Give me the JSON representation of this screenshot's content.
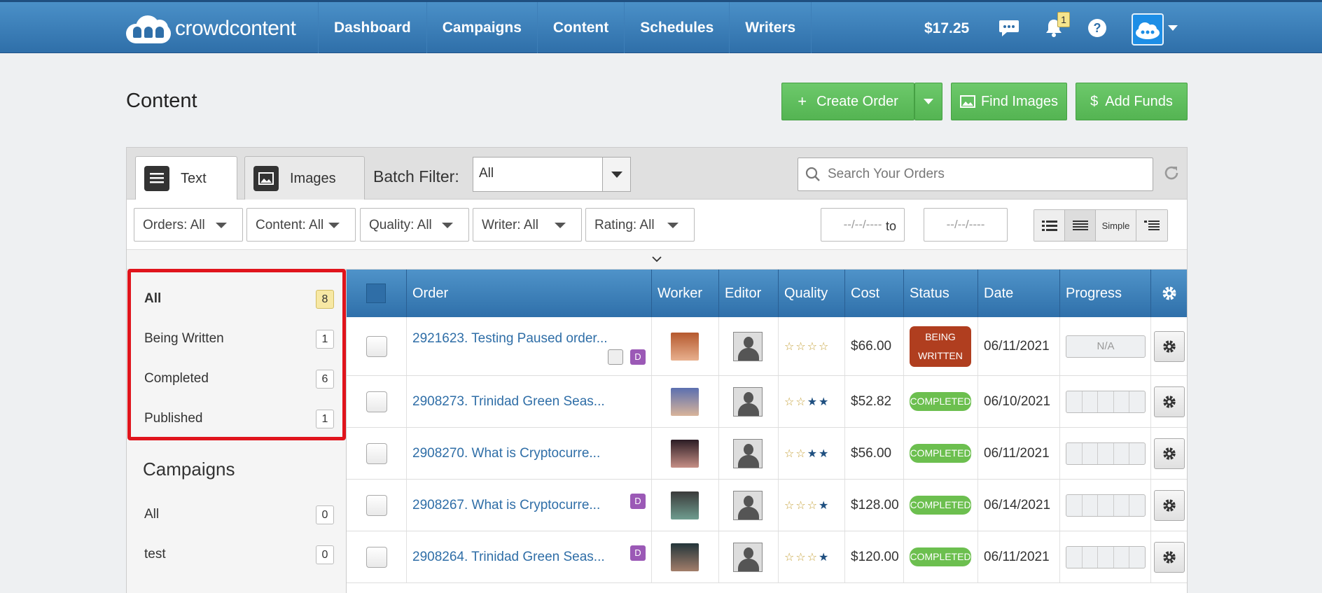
{
  "header": {
    "logo_text": "crowdcontent",
    "nav": [
      "Dashboard",
      "Campaigns",
      "Content",
      "Schedules",
      "Writers"
    ],
    "balance": "$17.25",
    "notification_count": "1"
  },
  "page": {
    "title": "Content",
    "buttons": {
      "create_order": "Create Order",
      "find_images": "Find Images",
      "add_funds": "Add Funds"
    }
  },
  "tabs": {
    "text": "Text",
    "images": "Images"
  },
  "batch": {
    "label": "Batch Filter:",
    "value": "All"
  },
  "search": {
    "placeholder": "Search Your Orders"
  },
  "filters": {
    "orders": "Orders: All",
    "content": "Content: All",
    "quality": "Quality: All",
    "writer": "Writer: All",
    "rating": "Rating: All",
    "date_from": "--/--/----",
    "to": "to",
    "date_to": "--/--/----",
    "view_simple": "Simple"
  },
  "sidebar": {
    "statuses": [
      {
        "label": "All",
        "count": "8"
      },
      {
        "label": "Being Written",
        "count": "1"
      },
      {
        "label": "Completed",
        "count": "6"
      },
      {
        "label": "Published",
        "count": "1"
      }
    ],
    "campaigns_title": "Campaigns",
    "campaigns": [
      {
        "label": "All",
        "count": "0"
      },
      {
        "label": "test",
        "count": "0"
      }
    ]
  },
  "table": {
    "headers": [
      "Order",
      "Worker",
      "Editor",
      "Quality",
      "Cost",
      "Status",
      "Date",
      "Progress"
    ],
    "rows": [
      {
        "order": "2921623. Testing Paused order...",
        "cost": "$66.00",
        "status": "BEING WRITTEN",
        "date": "06/11/2021",
        "progress": "N/A",
        "quality_filled": 0,
        "d_badge": "D"
      },
      {
        "order": "2908273. Trinidad Green Seas...",
        "cost": "$52.82",
        "status": "COMPLETED",
        "date": "06/10/2021",
        "quality_filled": 2
      },
      {
        "order": "2908270. What is Cryptocurre...",
        "cost": "$56.00",
        "status": "COMPLETED",
        "date": "06/11/2021",
        "quality_filled": 2
      },
      {
        "order": "2908267. What is Cryptocurre...",
        "cost": "$128.00",
        "status": "COMPLETED",
        "date": "06/14/2021",
        "quality_filled": 1,
        "d_badge": "D"
      },
      {
        "order": "2908264. Trinidad Green Seas...",
        "cost": "$120.00",
        "status": "COMPLETED",
        "date": "06/11/2021",
        "quality_filled": 1,
        "d_badge": "D"
      }
    ]
  },
  "colors": {
    "header_blue": "#2f6fa9",
    "accent_green": "#5cb85c",
    "status_writing": "#b03e1f",
    "status_completed": "#6cbf4f",
    "highlight_red": "#e0141c"
  }
}
